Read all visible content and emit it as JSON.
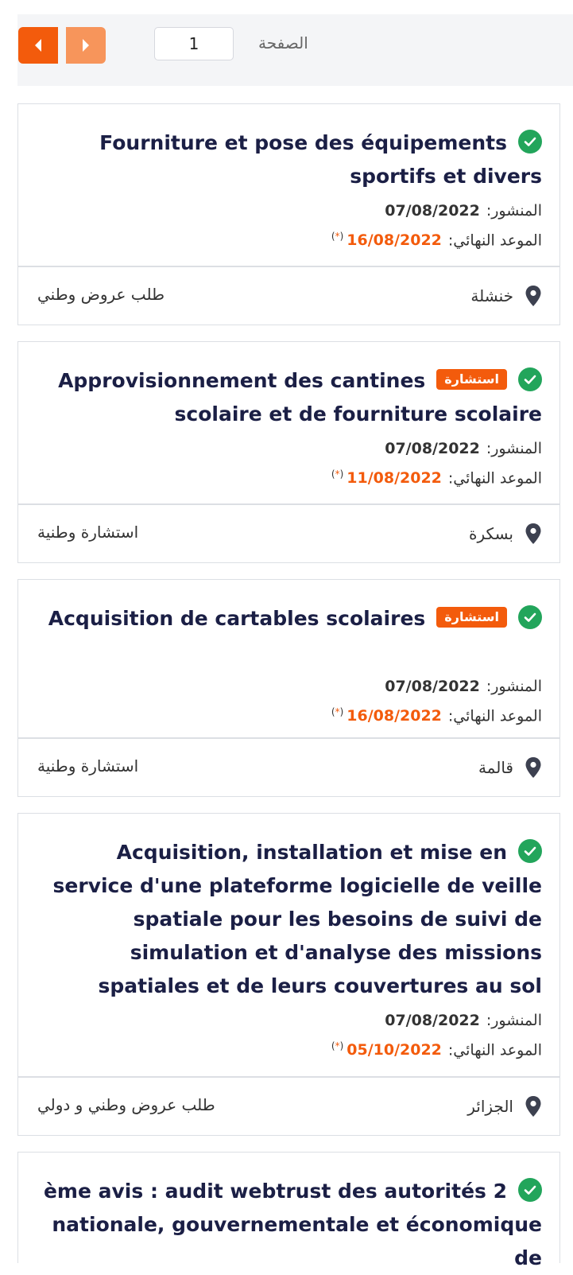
{
  "pager": {
    "page_value": "1",
    "page_label": "الصفحة",
    "prev_icon": "chevron-left-icon",
    "next_icon": "chevron-right-icon"
  },
  "labels": {
    "published": "المنشور:",
    "deadline": "الموعد النهائي:",
    "asterisk": "*"
  },
  "tenders": [
    {
      "title": "Fourniture et pose des équipements sportifs et divers",
      "badge": "",
      "published": "07/08/2022",
      "deadline": "16/08/2022",
      "location": "خنشلة",
      "type": "طلب عروض وطني"
    },
    {
      "title": "Approvisionnement des cantines scolaire et de fourniture scolaire",
      "badge": "استشارة",
      "published": "07/08/2022",
      "deadline": "11/08/2022",
      "location": "بسكرة",
      "type": "استشارة وطنية"
    },
    {
      "title": "Acquisition de cartables scolaires",
      "badge": "استشارة",
      "published": "07/08/2022",
      "deadline": "16/08/2022",
      "location": "قالمة",
      "type": "استشارة وطنية"
    },
    {
      "title": "Acquisition, installation et mise en service d'une plateforme logicielle de veille spatiale pour les besoins de suivi de simulation et d'analyse des missions spatiales et de leurs couvertures au sol",
      "badge": "",
      "published": "07/08/2022",
      "deadline": "05/10/2022",
      "location": "الجزائر",
      "type": "طلب عروض وطني و دولي"
    },
    {
      "title": "ème avis : audit webtrust des autorités 2 nationale, gouvernementale et économique de",
      "badge": "",
      "published": "",
      "deadline": "",
      "location": "",
      "type": ""
    }
  ],
  "colors": {
    "accent": "#f35b0c",
    "accent_light": "#f7955b",
    "check": "#22a55b",
    "title": "#1b1f45"
  }
}
